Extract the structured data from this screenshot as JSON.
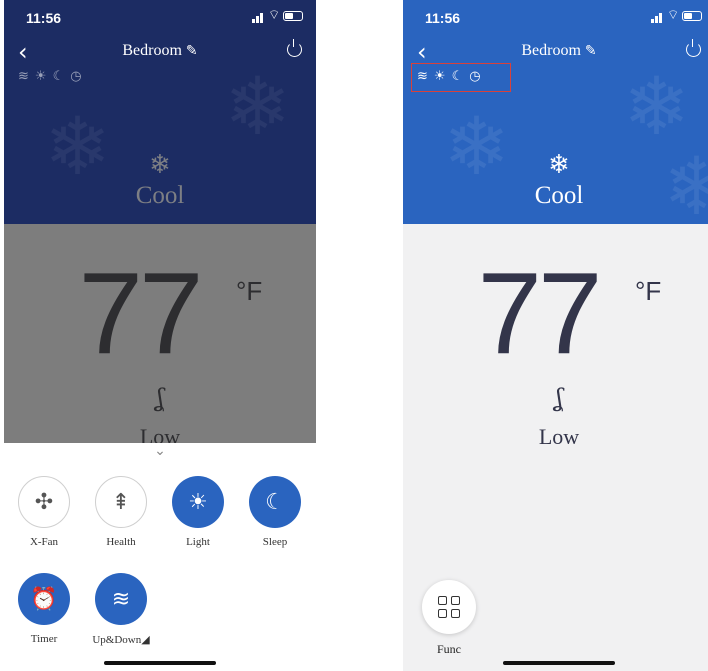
{
  "colors": {
    "accent": "#2a64bf",
    "dim_header": "#1c2c63",
    "highlight": "#d9413a"
  },
  "left": {
    "status": {
      "time": "11:56"
    },
    "nav": {
      "back": "‹",
      "room": "Bedroom",
      "edit_icon": "pencil-icon",
      "power_icon": "power-icon"
    },
    "mode": {
      "icon": "❄",
      "label": "Cool"
    },
    "temp": {
      "value": "77",
      "unit": "°F"
    },
    "fan": {
      "icon": "ʆ",
      "label": "Low"
    },
    "sheet": {
      "chevron": "⌄",
      "functions": [
        {
          "icon": "✣",
          "label": "X-Fan",
          "active": false
        },
        {
          "icon": "⇞",
          "label": "Health",
          "active": false
        },
        {
          "icon": "☀",
          "label": "Light",
          "active": true
        },
        {
          "icon": "☾",
          "label": "Sleep",
          "active": true
        },
        {
          "icon": "⏰",
          "label": "Timer",
          "active": true
        },
        {
          "icon": "≋",
          "label": "Up&Down◢",
          "active": true
        }
      ]
    }
  },
  "right": {
    "status": {
      "time": "11:56"
    },
    "nav": {
      "back": "‹",
      "room": "Bedroom",
      "edit_icon": "pencil-icon",
      "power_icon": "power-icon"
    },
    "mode": {
      "icon": "❄",
      "label": "Cool"
    },
    "temp": {
      "value": "77",
      "unit": "°F"
    },
    "fan": {
      "icon": "ʆ",
      "label": "Low"
    },
    "func_button": {
      "label": "Func"
    }
  }
}
